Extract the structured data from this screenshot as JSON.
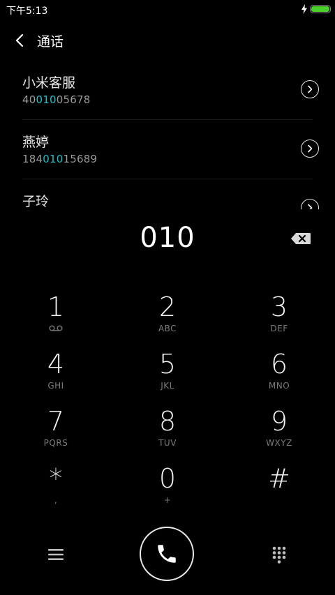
{
  "status_bar": {
    "time": "下午5:13",
    "battery_level": 1.0,
    "charging": true,
    "battery_color": "#4bd02b"
  },
  "header": {
    "title": "通话",
    "back_icon": "chevron-left-icon"
  },
  "contacts": [
    {
      "name": "小米客服",
      "number_prefix": "40",
      "number_match": "010",
      "number_suffix": "05678"
    },
    {
      "name": "燕婷",
      "number_prefix": "184",
      "number_match": "010",
      "number_suffix": "15689"
    },
    {
      "name": "子玲",
      "number_prefix": "",
      "number_match": "",
      "number_suffix": ""
    }
  ],
  "highlight_color": "#1bbfc8",
  "dial_input": {
    "value": "010"
  },
  "keypad": {
    "keys": [
      {
        "digit": "1",
        "letters": "",
        "icon": "voicemail-icon"
      },
      {
        "digit": "2",
        "letters": "ABC"
      },
      {
        "digit": "3",
        "letters": "DEF"
      },
      {
        "digit": "4",
        "letters": "GHI"
      },
      {
        "digit": "5",
        "letters": "JKL"
      },
      {
        "digit": "6",
        "letters": "MNO"
      },
      {
        "digit": "7",
        "letters": "PQRS"
      },
      {
        "digit": "8",
        "letters": "TUV"
      },
      {
        "digit": "9",
        "letters": "WXYZ"
      },
      {
        "digit": "*",
        "letters": ","
      },
      {
        "digit": "0",
        "letters": "+"
      },
      {
        "digit": "#",
        "letters": ""
      }
    ]
  },
  "bottom_bar": {
    "menu_icon": "hamburger-menu-icon",
    "call_icon": "phone-icon",
    "keypad_icon": "dialpad-icon"
  }
}
